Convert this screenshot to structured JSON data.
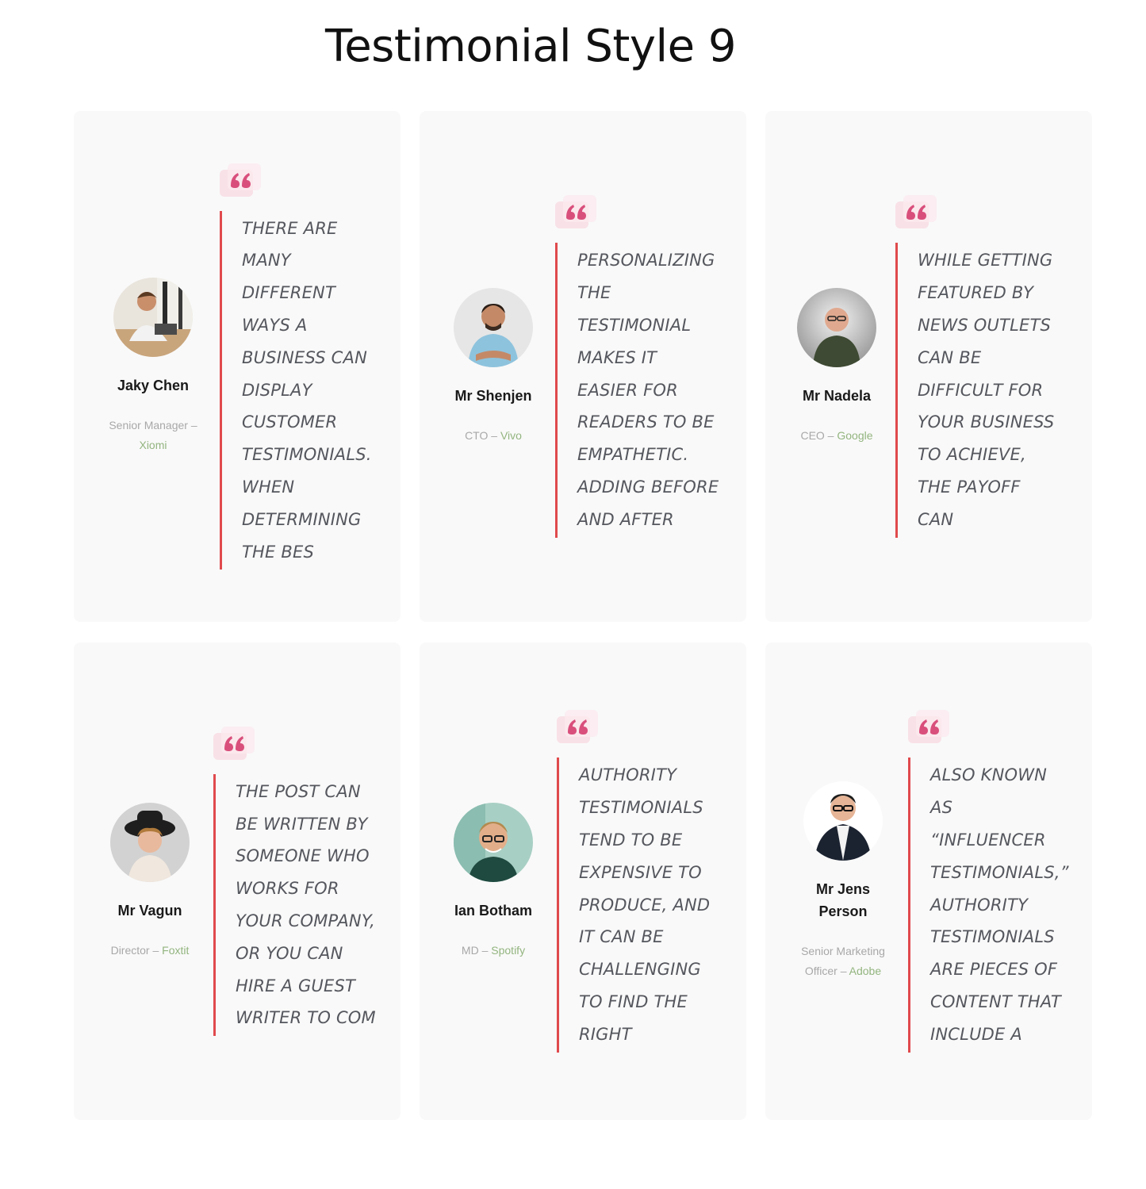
{
  "page": {
    "title": "Testimonial Style 9"
  },
  "colors": {
    "card_bg": "#f9f9f9",
    "accent_red": "#e04a4d",
    "quote_icon": "#d94f7c",
    "company": "#93b57f",
    "role": "#a8a8a8"
  },
  "testimonials": [
    {
      "quote": "There are many different ways a business can display customer testimonials. When determining the bes",
      "name": "Jaky Chen",
      "role": "Senior Manager",
      "company": "Xiomi",
      "avatar_icon": "person-at-desk-photo"
    },
    {
      "quote": "Personalizing the testimonial makes it easier for readers to be empathetic. Adding before and after",
      "name": "Mr Shenjen",
      "role": "CTO",
      "company": "Vivo",
      "avatar_icon": "man-arms-crossed-photo"
    },
    {
      "quote": "While getting featured by news outlets can be difficult for your business to achieve, the payoff can",
      "name": "Mr Nadela",
      "role": "CEO",
      "company": "Google",
      "avatar_icon": "man-glasses-photo"
    },
    {
      "quote": "The post can be written by someone who works for your company, or you can hire a guest writer to com",
      "name": "Mr Vagun",
      "role": "Director",
      "company": "Foxtit",
      "avatar_icon": "young-man-hat-photo"
    },
    {
      "quote": "Authority testimonials tend to be expensive to produce, and it can be challenging to find the right",
      "name": "Ian Botham",
      "role": "MD",
      "company": "Spotify",
      "avatar_icon": "smiling-man-glasses-photo"
    },
    {
      "quote": "Also known as “influencer testimonials,” authority testimonials are pieces of content that include a",
      "name": "Mr Jens Person",
      "role": "Senior Marketing Officer",
      "company": "Adobe",
      "avatar_icon": "businessman-suit-photo"
    }
  ]
}
